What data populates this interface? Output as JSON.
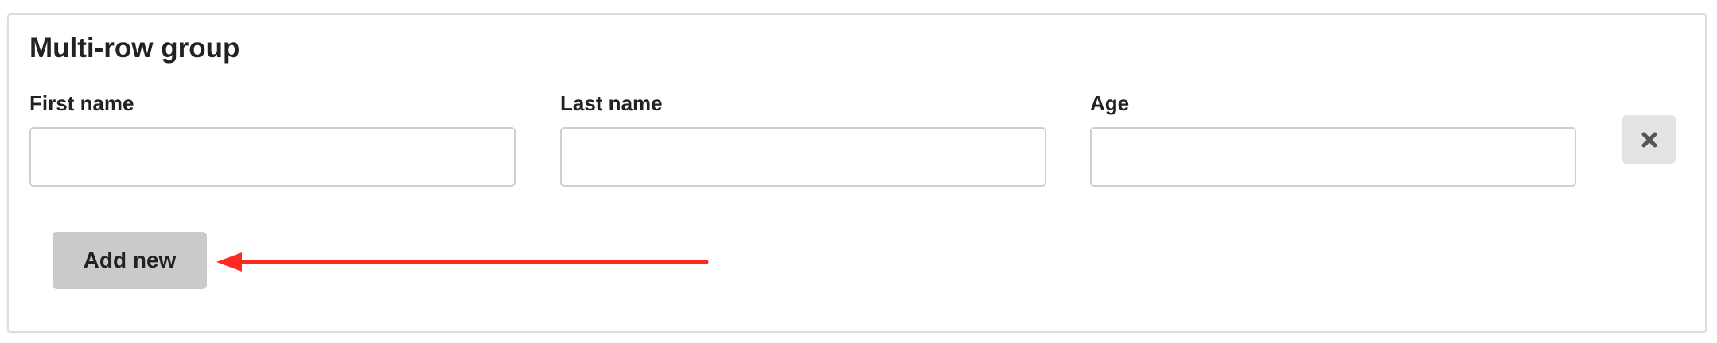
{
  "group": {
    "title": "Multi-row group"
  },
  "fields": [
    {
      "label": "First name",
      "value": "",
      "placeholder": ""
    },
    {
      "label": "Last name",
      "value": "",
      "placeholder": ""
    },
    {
      "label": "Age",
      "value": "",
      "placeholder": ""
    }
  ],
  "actions": {
    "remove_icon": "close-icon",
    "add_label": "Add new"
  },
  "annotation": {
    "arrow_color": "#ff2a1f"
  }
}
